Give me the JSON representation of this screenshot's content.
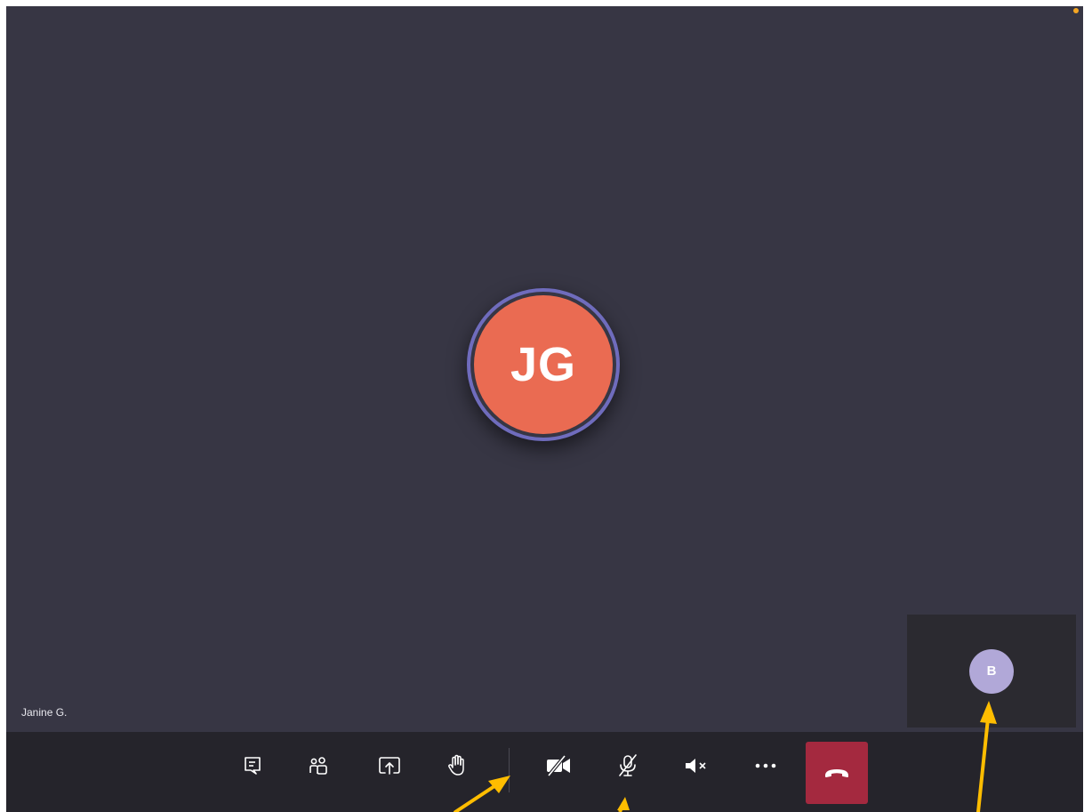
{
  "meeting": {
    "participant_name": "Janine G.",
    "participant_initials": "JG",
    "self_initials": "B"
  },
  "toolbar": {
    "buttons": [
      {
        "id": "chat",
        "icon": "chat-icon"
      },
      {
        "id": "participants",
        "icon": "people-icon"
      },
      {
        "id": "share",
        "icon": "share-screen-icon"
      },
      {
        "id": "raise-hand",
        "icon": "raise-hand-icon"
      },
      {
        "id": "camera",
        "icon": "camera-off-icon"
      },
      {
        "id": "microphone",
        "icon": "mic-off-icon"
      },
      {
        "id": "speaker",
        "icon": "speaker-mute-icon"
      },
      {
        "id": "more",
        "icon": "more-icon"
      },
      {
        "id": "hang-up",
        "icon": "phone-hangup-icon"
      }
    ]
  },
  "colors": {
    "stage_bg": "#373644",
    "toolbar_bg": "#25242b",
    "main_avatar": "#ea6b52",
    "main_avatar_ring": "#6f6cbd",
    "self_avatar": "#b1a8d8",
    "hangup": "#a4293f",
    "annotation_arrow": "#ffbd00",
    "status_dot": "#f5a623"
  }
}
